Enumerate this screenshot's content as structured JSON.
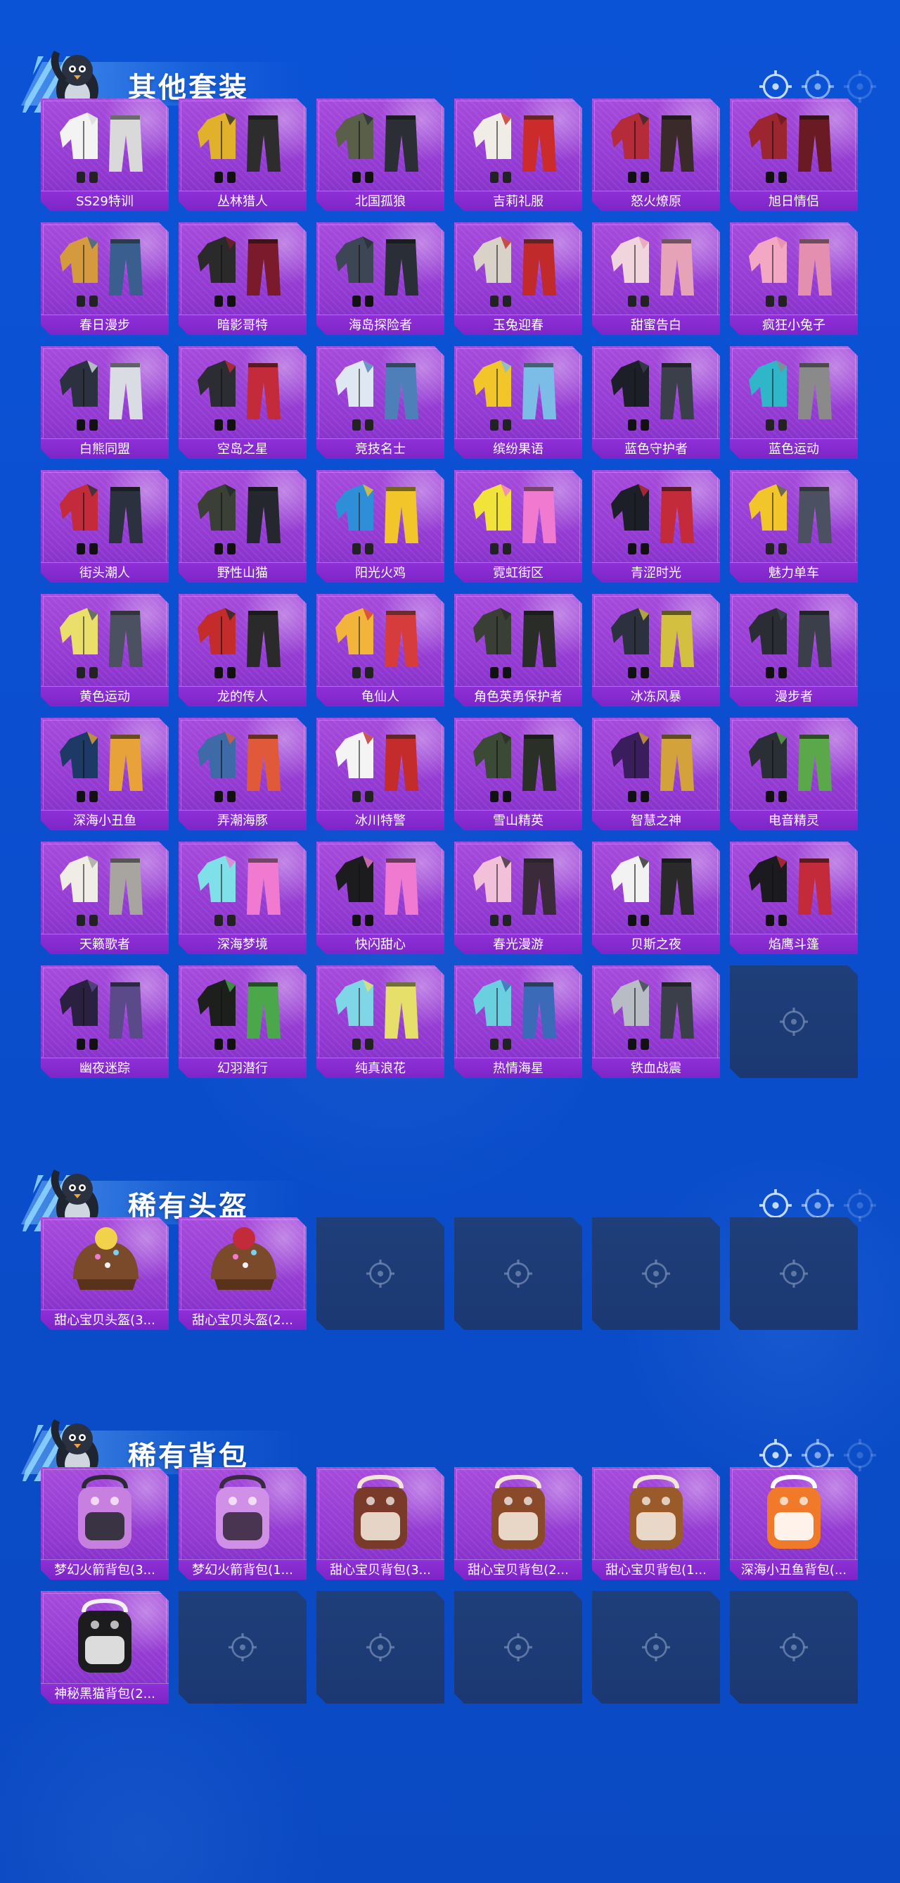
{
  "theme": {
    "background": "#0b53d6",
    "card_fill": "#9b42d6",
    "card_label_bg": "#8a2dd4",
    "empty_slot": "#1d3c76",
    "title_text": "#ffffff"
  },
  "sections": [
    {
      "title": "其他套装",
      "items": [
        "SS29特训",
        "丛林猎人",
        "北国孤狼",
        "吉莉礼服",
        "怒火燎原",
        "旭日情侣",
        "春日漫步",
        "暗影哥特",
        "海岛探险者",
        "玉兔迎春",
        "甜蜜告白",
        "疯狂小兔子",
        "白熊同盟",
        "空岛之星",
        "竞技名士",
        "缤纷果语",
        "蓝色守护者",
        "蓝色运动",
        "街头潮人",
        "野性山猫",
        "阳光火鸡",
        "霓虹街区",
        "青涩时光",
        "魅力单车",
        "黄色运动",
        "龙的传人",
        "龟仙人",
        "角色英勇保护者",
        "冰冻风暴",
        "漫步者",
        "深海小丑鱼",
        "弄潮海豚",
        "冰川特警",
        "雪山精英",
        "智慧之神",
        "电音精灵",
        "天籁歌者",
        "深海梦境",
        "快闪甜心",
        "春光漫游",
        "贝斯之夜",
        "焰鹰斗篷",
        "幽夜迷踪",
        "幻羽潜行",
        "纯真浪花",
        "热情海星",
        "铁血战震"
      ],
      "empty_slots": 1
    },
    {
      "title": "稀有头盔",
      "items": [
        "甜心宝贝头盔(3...",
        "甜心宝贝头盔(2..."
      ],
      "empty_slots": 4
    },
    {
      "title": "稀有背包",
      "items": [
        "梦幻火箭背包(3...",
        "梦幻火箭背包(1...",
        "甜心宝贝背包(3...",
        "甜心宝贝背包(2...",
        "甜心宝贝背包(1...",
        "深海小丑鱼背包(...",
        "神秘黑猫背包(2..."
      ],
      "empty_slots": 5
    }
  ],
  "icons": {
    "section_mascot": "penguin-mascot-icon",
    "pager_dot": "crosshair-icon",
    "empty_slot": "crosshair-icon"
  }
}
